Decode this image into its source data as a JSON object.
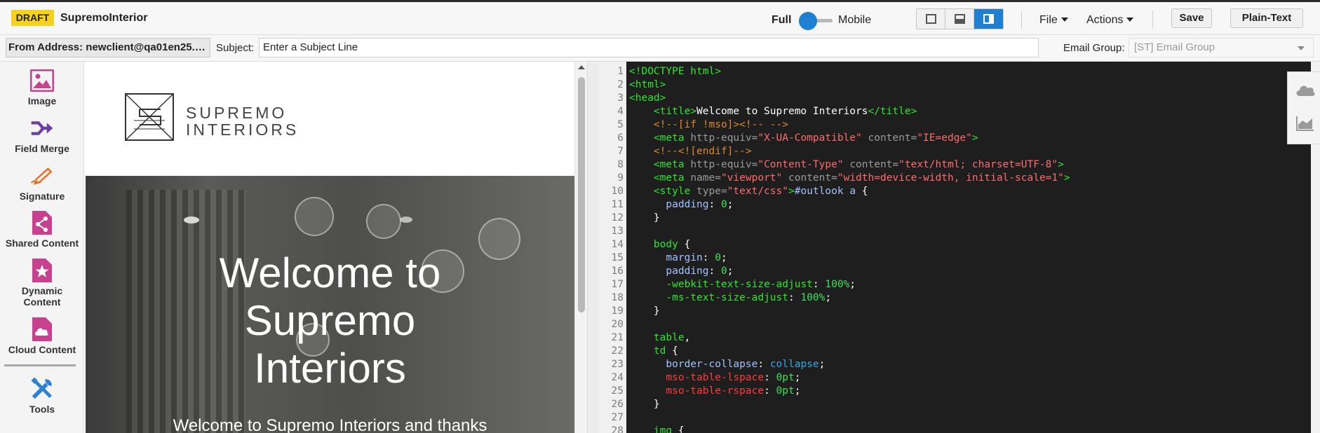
{
  "header": {
    "badge": "DRAFT",
    "title": "SupremoInterior",
    "view_full": "Full",
    "view_mobile": "Mobile",
    "layout_buttons": [
      "single-pane-icon",
      "bottom-pane-icon",
      "right-pane-icon"
    ],
    "file_menu": "File",
    "actions_menu": "Actions",
    "save_label": "Save",
    "plain_text_label": "Plain-Text"
  },
  "subject_row": {
    "from_address": "From Address: newclient@qa01en25.…",
    "subject_label": "Subject:",
    "subject_placeholder": "Enter a Subject Line",
    "email_group_label": "Email Group:",
    "email_group_value": "[ST] Email Group"
  },
  "palette": {
    "items": [
      {
        "label": "Image",
        "icon": "image-icon"
      },
      {
        "label": "Field Merge",
        "icon": "field-merge-icon"
      },
      {
        "label": "Signature",
        "icon": "signature-icon"
      },
      {
        "label": "Shared Content",
        "icon": "shared-content-icon"
      },
      {
        "label_line1": "Dynamic",
        "label_line2": "Content",
        "icon": "dynamic-content-icon"
      },
      {
        "label": "Cloud Content",
        "icon": "cloud-content-icon"
      },
      {
        "label": "Tools",
        "icon": "tools-icon"
      }
    ]
  },
  "preview": {
    "logo_line1": "SUPREMO",
    "logo_line2": "INTERIORS",
    "hero_title_line1": "Welcome to",
    "hero_title_line2": "Supremo",
    "hero_title_line3": "Interiors",
    "hero_subtitle": "Welcome to Supremo Interiors and thanks"
  },
  "colors": {
    "accent": "#1f7fd0",
    "draft": "#f6d21c",
    "palette_icon": "#c8418f",
    "editor_bg": "#1e1e1e"
  }
}
